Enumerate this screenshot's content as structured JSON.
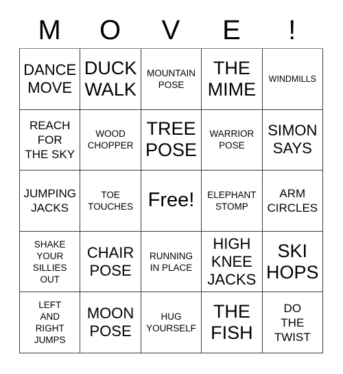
{
  "header": {
    "letters": [
      "M",
      "O",
      "V",
      "E",
      "!"
    ]
  },
  "grid": {
    "columns": 5,
    "rows": 5,
    "cells": [
      {
        "text": "DANCE\nMOVE",
        "size": "lg"
      },
      {
        "text": "DUCK\nWALK",
        "size": "xl"
      },
      {
        "text": "MOUNTAIN\nPOSE",
        "size": "sm"
      },
      {
        "text": "THE\nMIME",
        "size": "xl"
      },
      {
        "text": "WINDMILLS",
        "size": "xs"
      },
      {
        "text": "REACH\nFOR\nTHE SKY",
        "size": "md"
      },
      {
        "text": "WOOD\nCHOPPER",
        "size": "sm"
      },
      {
        "text": "TREE\nPOSE",
        "size": "xl"
      },
      {
        "text": "WARRIOR\nPOSE",
        "size": "sm"
      },
      {
        "text": "SIMON\nSAYS",
        "size": "lg"
      },
      {
        "text": "JUMPING\nJACKS",
        "size": "md"
      },
      {
        "text": "TOE\nTOUCHES",
        "size": "sm"
      },
      {
        "text": "Free!",
        "size": "free"
      },
      {
        "text": "ELEPHANT\nSTOMP",
        "size": "sm"
      },
      {
        "text": "ARM\nCIRCLES",
        "size": "md"
      },
      {
        "text": "SHAKE\nYOUR\nSILLIES\nOUT",
        "size": "sm"
      },
      {
        "text": "CHAIR\nPOSE",
        "size": "lg"
      },
      {
        "text": "RUNNING\nIN PLACE",
        "size": "sm"
      },
      {
        "text": "HIGH\nKNEE\nJACKS",
        "size": "lg"
      },
      {
        "text": "SKI\nHOPS",
        "size": "xl"
      },
      {
        "text": "LEFT\nAND\nRIGHT\nJUMPS",
        "size": "sm"
      },
      {
        "text": "MOON\nPOSE",
        "size": "lg"
      },
      {
        "text": "HUG\nYOURSELF",
        "size": "sm"
      },
      {
        "text": "THE\nFISH",
        "size": "xl"
      },
      {
        "text": "DO\nTHE\nTWIST",
        "size": "md"
      }
    ]
  },
  "colors": {
    "border": "#3b3b3b",
    "text": "#000000",
    "background": "#ffffff"
  }
}
